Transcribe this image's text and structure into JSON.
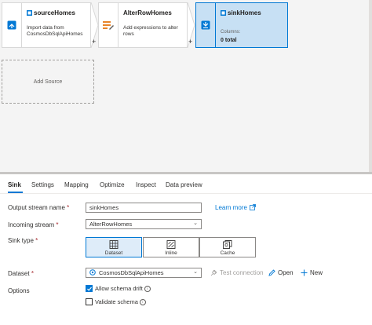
{
  "canvas": {
    "nodes": [
      {
        "title": "sourceHomes",
        "desc_line1": "Import data from",
        "desc_line2": "CosmosDbSqlApiHomes"
      },
      {
        "title": "AlterRowHomes",
        "desc_line1": "Add expressions to alter rows"
      },
      {
        "title": "sinkHomes",
        "columns_label": "Columns:",
        "columns_total": "0 total"
      }
    ],
    "plus_label": "+",
    "add_source_label": "Add Source"
  },
  "tabs": [
    "Sink",
    "Settings",
    "Mapping",
    "Optimize",
    "Inspect",
    "Data preview"
  ],
  "active_tab": "Sink",
  "form": {
    "output_stream": {
      "label": "Output stream name",
      "required": "*",
      "value": "sinkHomes",
      "learn_more": "Learn more"
    },
    "incoming_stream": {
      "label": "Incoming stream",
      "required": "*",
      "value": "AlterRowHomes"
    },
    "sink_type": {
      "label": "Sink type",
      "required": "*",
      "options": [
        "Dataset",
        "Inline",
        "Cache"
      ],
      "selected": "Dataset"
    },
    "dataset": {
      "label": "Dataset",
      "required": "*",
      "value": "CosmosDbSqlApiHomes",
      "test_connection": "Test connection",
      "open": "Open",
      "new": "New"
    },
    "options": {
      "label": "Options",
      "allow_schema_drift": {
        "label": "Allow schema drift",
        "checked": true
      },
      "validate_schema": {
        "label": "Validate schema",
        "checked": false
      }
    }
  },
  "colors": {
    "accent": "#0078d4",
    "selected_fill": "#deecf9",
    "sink_node_fill": "#c7e0f4",
    "alter_row_icon": "#e8852a"
  }
}
